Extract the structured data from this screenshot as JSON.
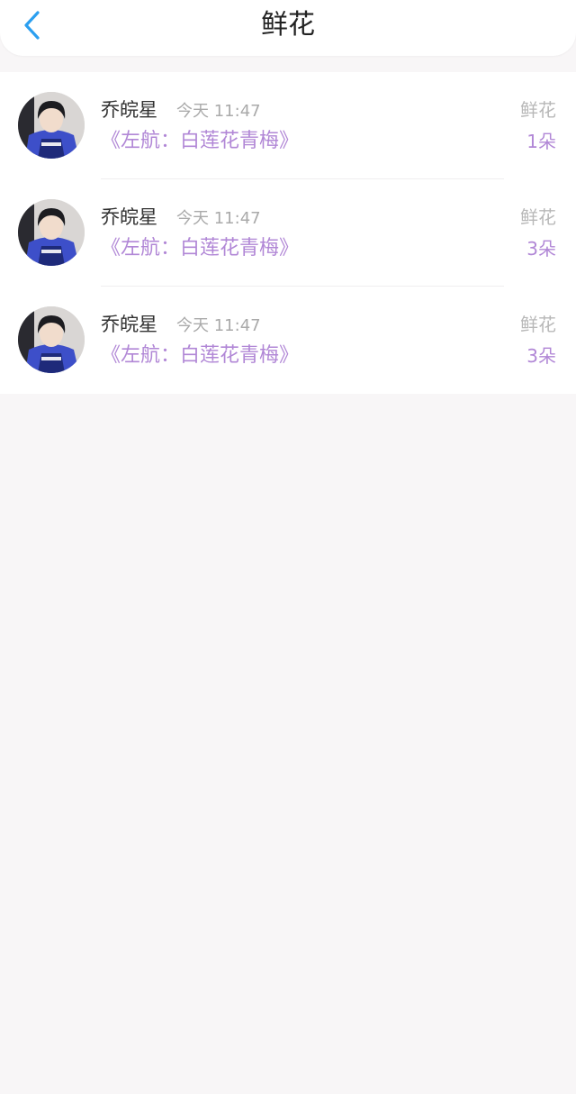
{
  "header": {
    "title": "鲜花",
    "back_icon": "chevron-left-icon",
    "accent_color": "#2b9ff0"
  },
  "colors": {
    "book_title": "#b187d6",
    "muted": "#aaaaaa",
    "background": "#f8f6f7"
  },
  "records": [
    {
      "user": "乔皖星",
      "time": "今天 11:47",
      "book": "《左航：白莲花青梅》",
      "gift": "鲜花",
      "count": "1朵",
      "avatar": "avatar-photo"
    },
    {
      "user": "乔皖星",
      "time": "今天 11:47",
      "book": "《左航：白莲花青梅》",
      "gift": "鲜花",
      "count": "3朵",
      "avatar": "avatar-photo"
    },
    {
      "user": "乔皖星",
      "time": "今天 11:47",
      "book": "《左航：白莲花青梅》",
      "gift": "鲜花",
      "count": "3朵",
      "avatar": "avatar-photo"
    }
  ]
}
